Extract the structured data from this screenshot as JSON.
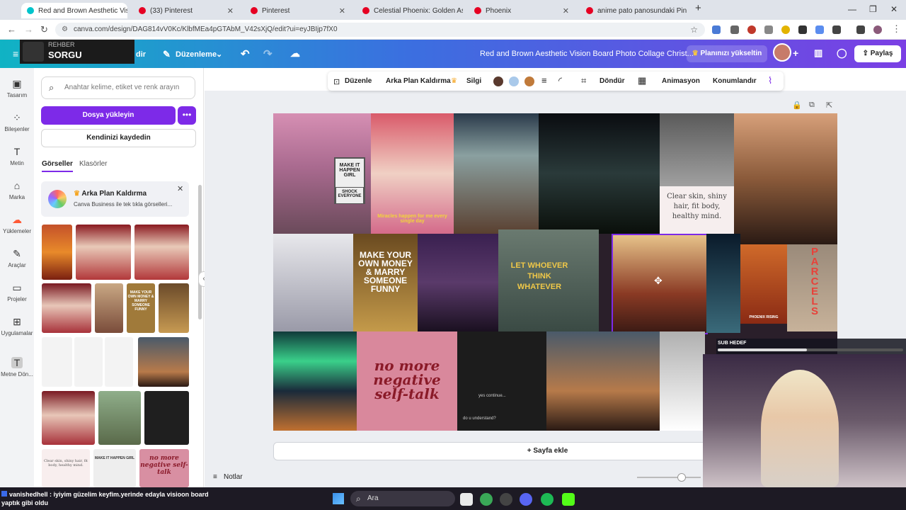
{
  "browser": {
    "tabs": [
      {
        "label": "Red and Brown Aesthetic Vision"
      },
      {
        "label": "(33) Pinterest"
      },
      {
        "label": "Pinterest"
      },
      {
        "label": "Celestial Phoenix: Golden Asce"
      },
      {
        "label": "Phoenix"
      },
      {
        "label": "anime pato panosundaki Pin"
      }
    ],
    "new_tab": "+",
    "url": "canva.com/design/DAG814vV0Kc/KlbfMEa4pGTAbM_V42sXjQ/edit?ui=eyJBIjp7fX0"
  },
  "overlay": {
    "rehber": "REHBER",
    "sorgu": "SORGU"
  },
  "header": {
    "menu_partial": "dir",
    "edit": "Düzenleme",
    "title": "Red and Brown Aesthetic Vision Board Photo Collage Christ...",
    "upgrade": "Planınızı yükseltin",
    "share": "Paylaş"
  },
  "rail": [
    {
      "label": "Tasarım",
      "icon": "template-icon"
    },
    {
      "label": "Bileşenler",
      "icon": "elements-icon"
    },
    {
      "label": "Metin",
      "icon": "text-icon"
    },
    {
      "label": "Marka",
      "icon": "brand-icon"
    },
    {
      "label": "Yüklemeler",
      "icon": "upload-cloud-icon"
    },
    {
      "label": "Araçlar",
      "icon": "draw-icon"
    },
    {
      "label": "Projeler",
      "icon": "folder-icon"
    },
    {
      "label": "Uygulamalar",
      "icon": "apps-icon"
    },
    {
      "label": "Metne Dön...",
      "icon": "text-convert-icon"
    }
  ],
  "panel": {
    "search_placeholder": "Anahtar kelime, etiket ve renk arayın",
    "upload": "Dosya yükleyin",
    "save_yourself": "Kendinizi kaydedin",
    "tabs": [
      "Görseller",
      "Klasörler"
    ],
    "bg_remover_title": "Arka Plan Kaldırma",
    "bg_remover_desc": "Canva Business ile tek tıkla görselleri...",
    "thumb_texts": {
      "make_money": "MAKE YOUR OWN MONEY & MARRY SOMEONE FUNNY",
      "clear_skin": "Clear skin, shiny hair, fit body, healthy mind.",
      "make_it_happen": "MAKE IT HAPPEN GIRL",
      "no_more": "no more negative self-talk"
    }
  },
  "toolbar": {
    "edit": "Düzenle",
    "bg_remove": "Arka Plan Kaldırma",
    "erase": "Silgi",
    "colors": [
      "#5a3a2e",
      "#a9c9ea",
      "#c07a3a"
    ],
    "rotate": "Döndür",
    "animate": "Animasyon",
    "position": "Konumlandır"
  },
  "board": {
    "sign": "MAKE IT HAPPEN GIRL",
    "sign2": "SHOCK EVERYONE",
    "miracles": "Miracles happen for me every single day",
    "clear_skin": "Clear skin, shiny hair, fit body, healthy mind.",
    "money": "MAKE YOUR OWN MONEY & MARRY SOMEONE FUNNY",
    "let": "LET WHOEVER THINK WHATEVER",
    "parcels": "PARCELS",
    "phoenix": "PHOENIX RISING",
    "no_more": "no more negative self-talk",
    "understand": "do u understand?",
    "continue": "yes continue..."
  },
  "canvas": {
    "add_page": "+ Sayfa ekle",
    "notes": "Notlar"
  },
  "stream": {
    "sub_goal": "SUB HEDEF",
    "chat": "vanishedhell : iyiyim güzelim keyfim.yerinde edayla visioon board yaptık gibi oldu"
  },
  "taskbar": {
    "search": "Ara"
  }
}
